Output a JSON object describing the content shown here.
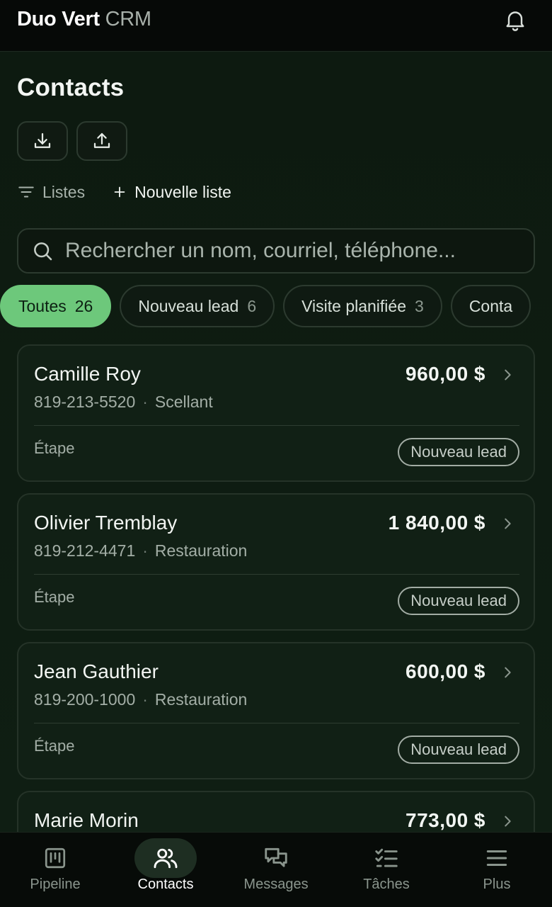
{
  "header": {
    "brand_primary": "Duo Vert",
    "brand_secondary": "CRM",
    "notification_icon": "bell-icon"
  },
  "page": {
    "title": "Contacts",
    "download_icon": "download-icon",
    "upload_icon": "upload-icon"
  },
  "lists": {
    "toggle_label": "Listes",
    "new_label": "Nouvelle liste"
  },
  "search": {
    "placeholder": "Rechercher un nom, courriel, téléphone..."
  },
  "filters": [
    {
      "label": "Toutes",
      "count": "26",
      "active": true
    },
    {
      "label": "Nouveau lead",
      "count": "6",
      "active": false
    },
    {
      "label": "Visite planifiée",
      "count": "3",
      "active": false
    },
    {
      "label": "Conta",
      "count": "",
      "active": false
    }
  ],
  "contacts": [
    {
      "name": "Camille Roy",
      "amount": "960,00 $",
      "phone": "819-213-5520",
      "category": "Scellant",
      "stage_label": "Étape",
      "stage": "Nouveau lead"
    },
    {
      "name": "Olivier Tremblay",
      "amount": "1 840,00 $",
      "phone": "819-212-4471",
      "category": "Restauration",
      "stage_label": "Étape",
      "stage": "Nouveau lead"
    },
    {
      "name": "Jean Gauthier",
      "amount": "600,00 $",
      "phone": "819-200-1000",
      "category": "Restauration",
      "stage_label": "Étape",
      "stage": "Nouveau lead"
    },
    {
      "name": "Marie Morin",
      "amount": "773,00 $",
      "phone": "",
      "category": "",
      "stage_label": "",
      "stage": ""
    }
  ],
  "nav": [
    {
      "label": "Pipeline",
      "icon": "pipeline-icon",
      "active": false
    },
    {
      "label": "Contacts",
      "icon": "contacts-icon",
      "active": true
    },
    {
      "label": "Messages",
      "icon": "messages-icon",
      "active": false
    },
    {
      "label": "Tâches",
      "icon": "tasks-icon",
      "active": false
    },
    {
      "label": "Plus",
      "icon": "menu-icon",
      "active": false
    }
  ],
  "colors": {
    "accent": "#6dc87b",
    "background": "#0e1a11",
    "card": "#112015"
  }
}
